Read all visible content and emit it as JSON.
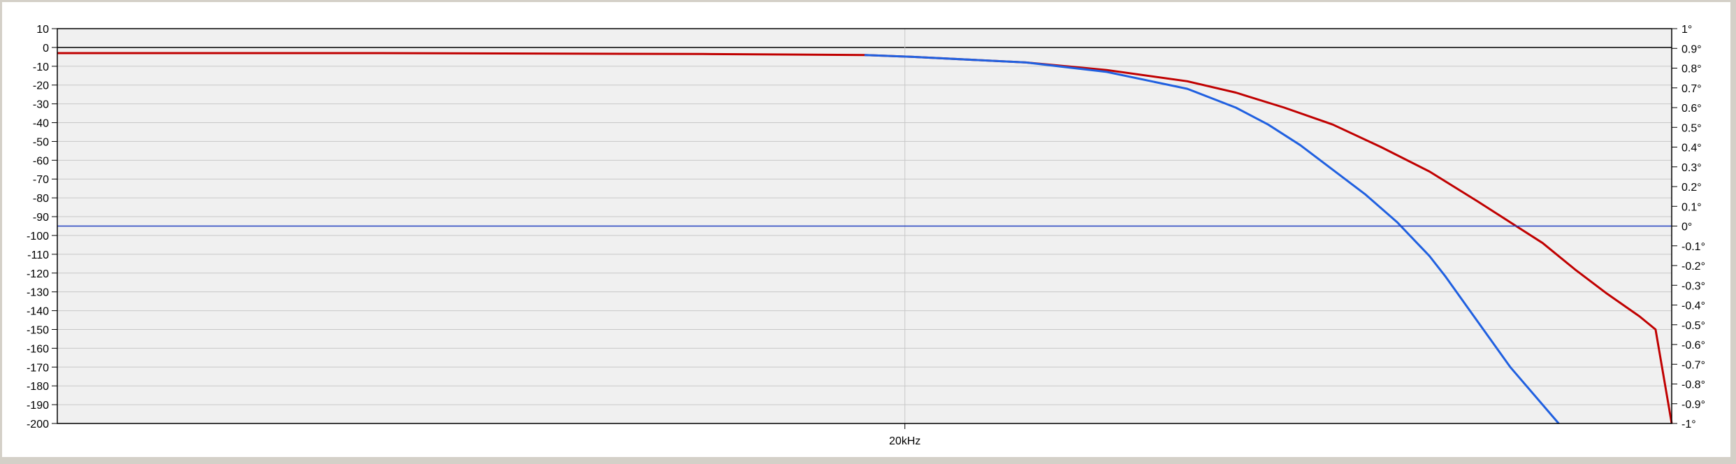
{
  "chart_data": {
    "type": "line",
    "xlabel": "",
    "ylabel": "",
    "x_ticks": [
      "20kHz"
    ],
    "ylim": [
      -200,
      10
    ],
    "y_ticks": [
      10,
      0,
      -10,
      -20,
      -30,
      -40,
      -50,
      -60,
      -70,
      -80,
      -90,
      -100,
      -110,
      -120,
      -130,
      -140,
      -150,
      -160,
      -170,
      -180,
      -190,
      -200
    ],
    "y2lim": [
      -1,
      1
    ],
    "y2_ticks": [
      "1°",
      "0.9°",
      "0.8°",
      "0.7°",
      "0.6°",
      "0.5°",
      "0.4°",
      "0.3°",
      "0.2°",
      "0.1°",
      "0°",
      "-0.1°",
      "-0.2°",
      "-0.3°",
      "-0.4°",
      "-0.5°",
      "-0.6°",
      "-0.7°",
      "-0.8°",
      "-0.9°",
      "-1°"
    ],
    "grid": true,
    "x_range_relative": [
      0,
      1
    ],
    "series": [
      {
        "color": "#c00000",
        "axis": "left",
        "x": [
          0,
          0.2,
          0.4,
          0.5,
          0.53,
          0.6,
          0.65,
          0.7,
          0.73,
          0.76,
          0.79,
          0.82,
          0.85,
          0.88,
          0.9,
          0.92,
          0.94,
          0.96,
          0.98,
          0.99,
          1.0
        ],
        "y": [
          -3,
          -3,
          -3.5,
          -4,
          -5,
          -8,
          -12,
          -18,
          -24,
          -32,
          -41,
          -53,
          -66,
          -82,
          -93,
          -104,
          -118,
          -131,
          -143,
          -150,
          -200
        ]
      },
      {
        "color": "#2060e0",
        "axis": "left",
        "x": [
          0.5,
          0.53,
          0.6,
          0.65,
          0.7,
          0.73,
          0.75,
          0.77,
          0.79,
          0.81,
          0.83,
          0.85,
          0.86,
          0.88,
          0.9,
          0.93
        ],
        "y": [
          -4,
          -5,
          -8,
          -13,
          -22,
          -32,
          -41,
          -52,
          -65,
          -78,
          -93,
          -111,
          -122,
          -146,
          -170,
          -200
        ]
      },
      {
        "color": "#2040c0",
        "axis": "right",
        "x": [
          0,
          1
        ],
        "y": [
          0,
          0
        ]
      }
    ]
  }
}
